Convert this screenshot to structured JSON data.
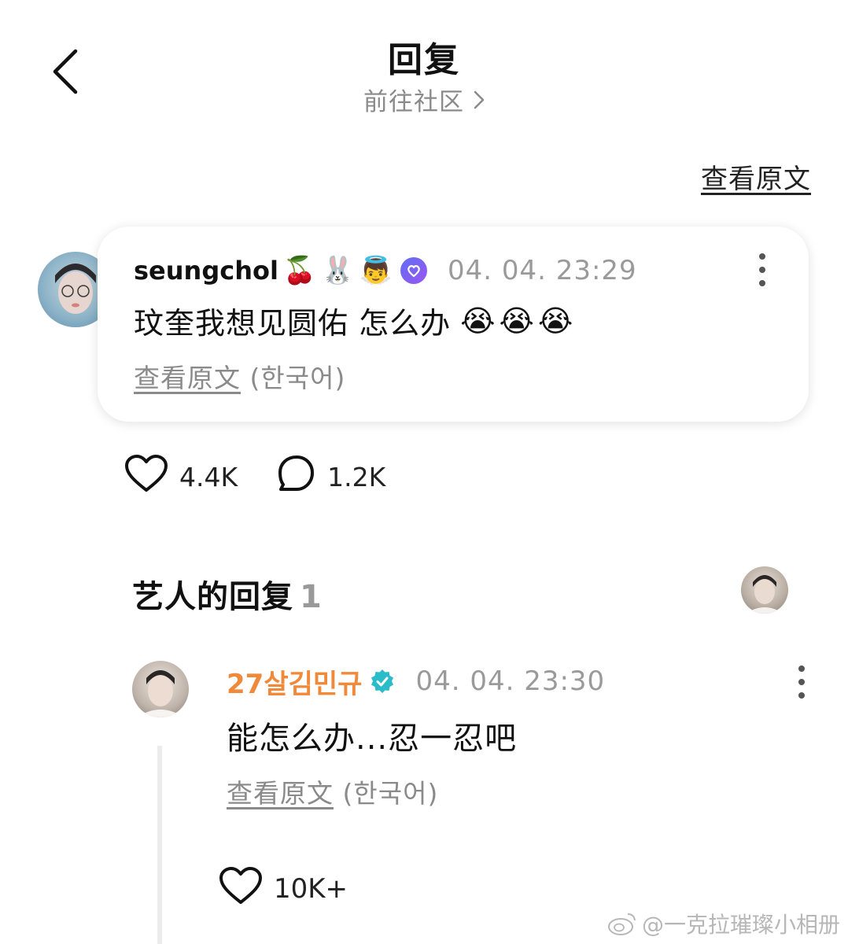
{
  "header": {
    "title": "回复",
    "community_link": "前往社区"
  },
  "view_original_top": "查看原文",
  "post": {
    "username": "seungchol",
    "name_emojis": [
      "🍒",
      "🐰",
      "👼"
    ],
    "timestamp": "04. 04. 23:29",
    "text": "玟奎我想见圆佑 怎么办",
    "text_emojis": [
      "😭",
      "😭",
      "😭"
    ],
    "translate_link": "查看原文",
    "translate_lang": "(한국어)"
  },
  "stats": {
    "likes": "4.4K",
    "comments": "1.2K"
  },
  "artist_section": {
    "title": "艺人的回复",
    "count": "1"
  },
  "reply": {
    "username": "27살김민규",
    "timestamp": "04. 04. 23:30",
    "text": "能怎么办...忍一忍吧",
    "translate_link": "查看原文",
    "translate_lang": "(한국어)",
    "likes": "10K+"
  },
  "watermark": "@一克拉璀璨小相册",
  "colors": {
    "artist_name": "#f0893a",
    "verified_fan_badge": "#6a62f2",
    "verified_artist_badge": "#2bbcc9"
  }
}
